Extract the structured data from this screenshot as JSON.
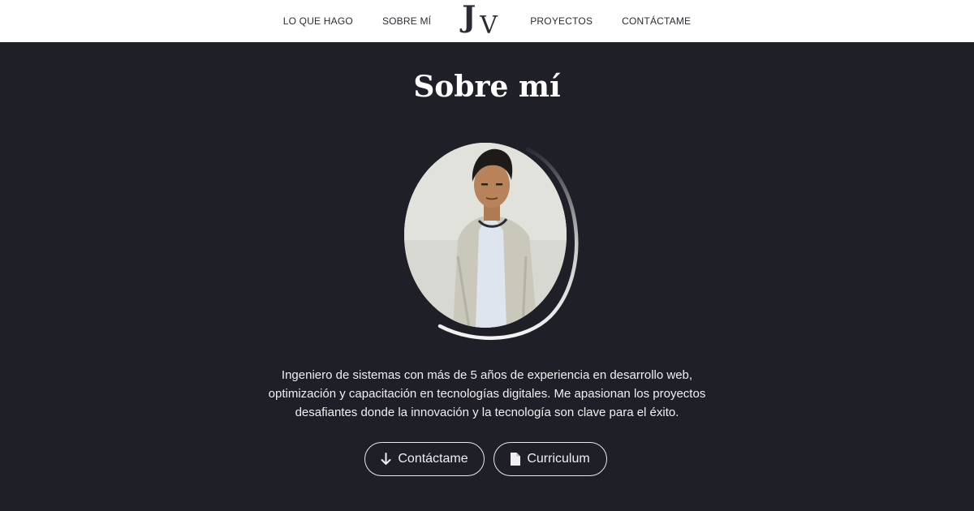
{
  "nav": {
    "left": [
      "LO QUE HAGO",
      "SOBRE MÍ"
    ],
    "right": [
      "PROYECTOS",
      "CONTÁCTAME"
    ],
    "logo": {
      "j": "J",
      "v": "V"
    }
  },
  "about": {
    "title": "Sobre mí",
    "bio": "Ingeniero de sistemas con más de 5 años de experiencia en desarrollo web, optimización y capacitación en tecnologías digitales. Me apasionan los proyectos desafiantes donde la innovación y la tecnología son clave para el éxito.",
    "buttons": {
      "contact": {
        "label": "Contáctame",
        "icon": "arrow-down-icon"
      },
      "cv": {
        "label": "Curriculum",
        "icon": "file-icon"
      }
    }
  },
  "colors": {
    "nav_bg": "#ffffff",
    "nav_text": "#2b2b35",
    "page_bg": "#1f1f27",
    "text": "#ffffff"
  }
}
